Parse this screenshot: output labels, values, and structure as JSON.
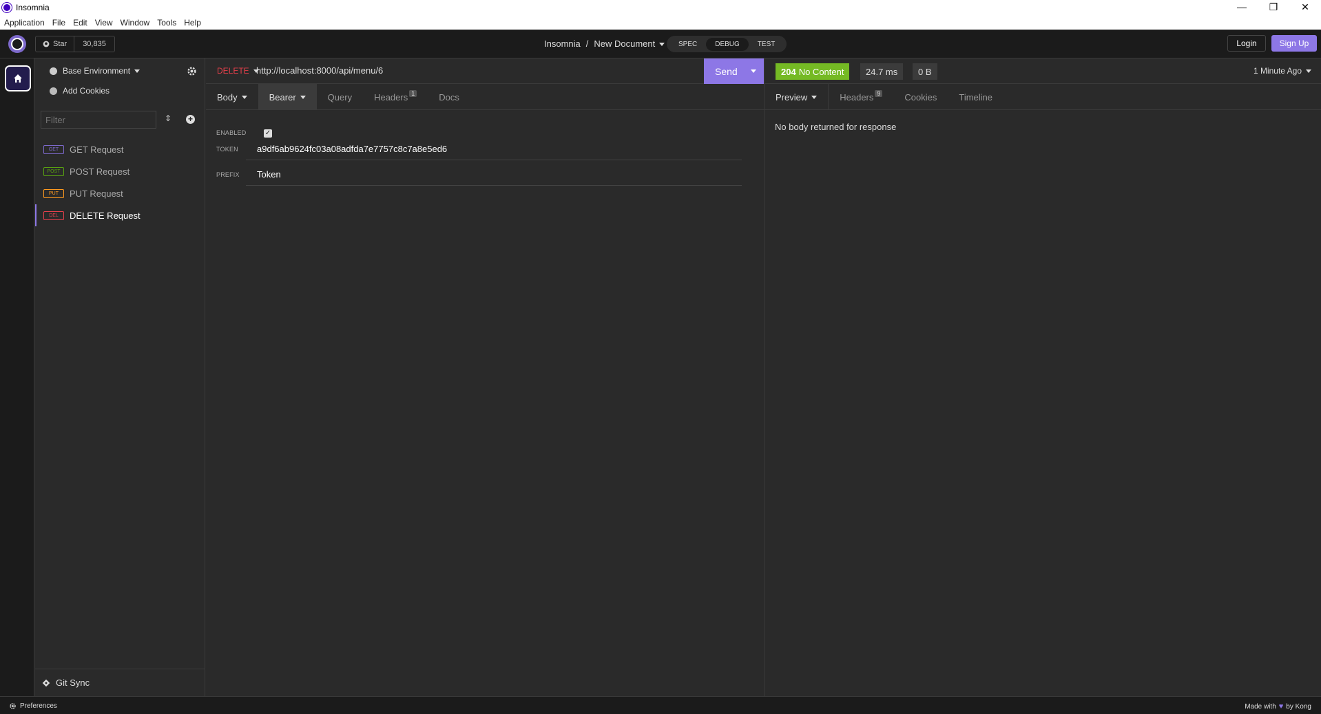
{
  "window": {
    "title": "Insomnia",
    "min": "—",
    "max": "❐",
    "close": "✕"
  },
  "menu": [
    "Application",
    "File",
    "Edit",
    "View",
    "Window",
    "Tools",
    "Help"
  ],
  "header": {
    "star_label": "Star",
    "star_count": "30,835",
    "breadcrumb_root": "Insomnia",
    "breadcrumb_sep": "/",
    "breadcrumb_doc": "New Document",
    "modes": [
      "SPEC",
      "DEBUG",
      "TEST"
    ],
    "active_mode": "DEBUG",
    "login": "Login",
    "signup": "Sign Up"
  },
  "sidebar": {
    "environment": "Base Environment",
    "add_cookies": "Add Cookies",
    "filter_placeholder": "Filter",
    "requests": [
      {
        "method": "GET",
        "name": "GET Request",
        "color": "#7d69cb"
      },
      {
        "method": "POST",
        "name": "POST Request",
        "color": "#59a210"
      },
      {
        "method": "PUT",
        "name": "PUT Request",
        "color": "#ff9a1f"
      },
      {
        "method": "DEL",
        "name": "DELETE Request",
        "color": "#e5404b"
      }
    ],
    "git_sync": "Git Sync"
  },
  "request": {
    "method": "DELETE",
    "url": "http://localhost:8000/api/menu/6",
    "send": "Send",
    "tabs": {
      "body": "Body",
      "auth": "Bearer",
      "query": "Query",
      "headers": "Headers",
      "headers_count": "1",
      "docs": "Docs"
    },
    "auth": {
      "enabled_label": "ENABLED",
      "token_label": "TOKEN",
      "token_value": "a9df6ab9624fc03a08adfda7e7757c8c7a8e5ed6",
      "prefix_label": "PREFIX",
      "prefix_value": "Token"
    }
  },
  "response": {
    "status_code": "204",
    "status_text": "No Content",
    "time": "24.7 ms",
    "size": "0 B",
    "ago": "1 Minute Ago",
    "tabs": {
      "preview": "Preview",
      "headers": "Headers",
      "headers_count": "9",
      "cookies": "Cookies",
      "timeline": "Timeline"
    },
    "message": "No body returned for response"
  },
  "statusbar": {
    "preferences": "Preferences",
    "made_with": "Made with",
    "by": "by Kong"
  },
  "colors": {
    "accent": "#8d77e6",
    "success": "#75ba24",
    "danger": "#e5404b",
    "background": "#2a2a2a",
    "header_bg": "#1b1b1b"
  }
}
